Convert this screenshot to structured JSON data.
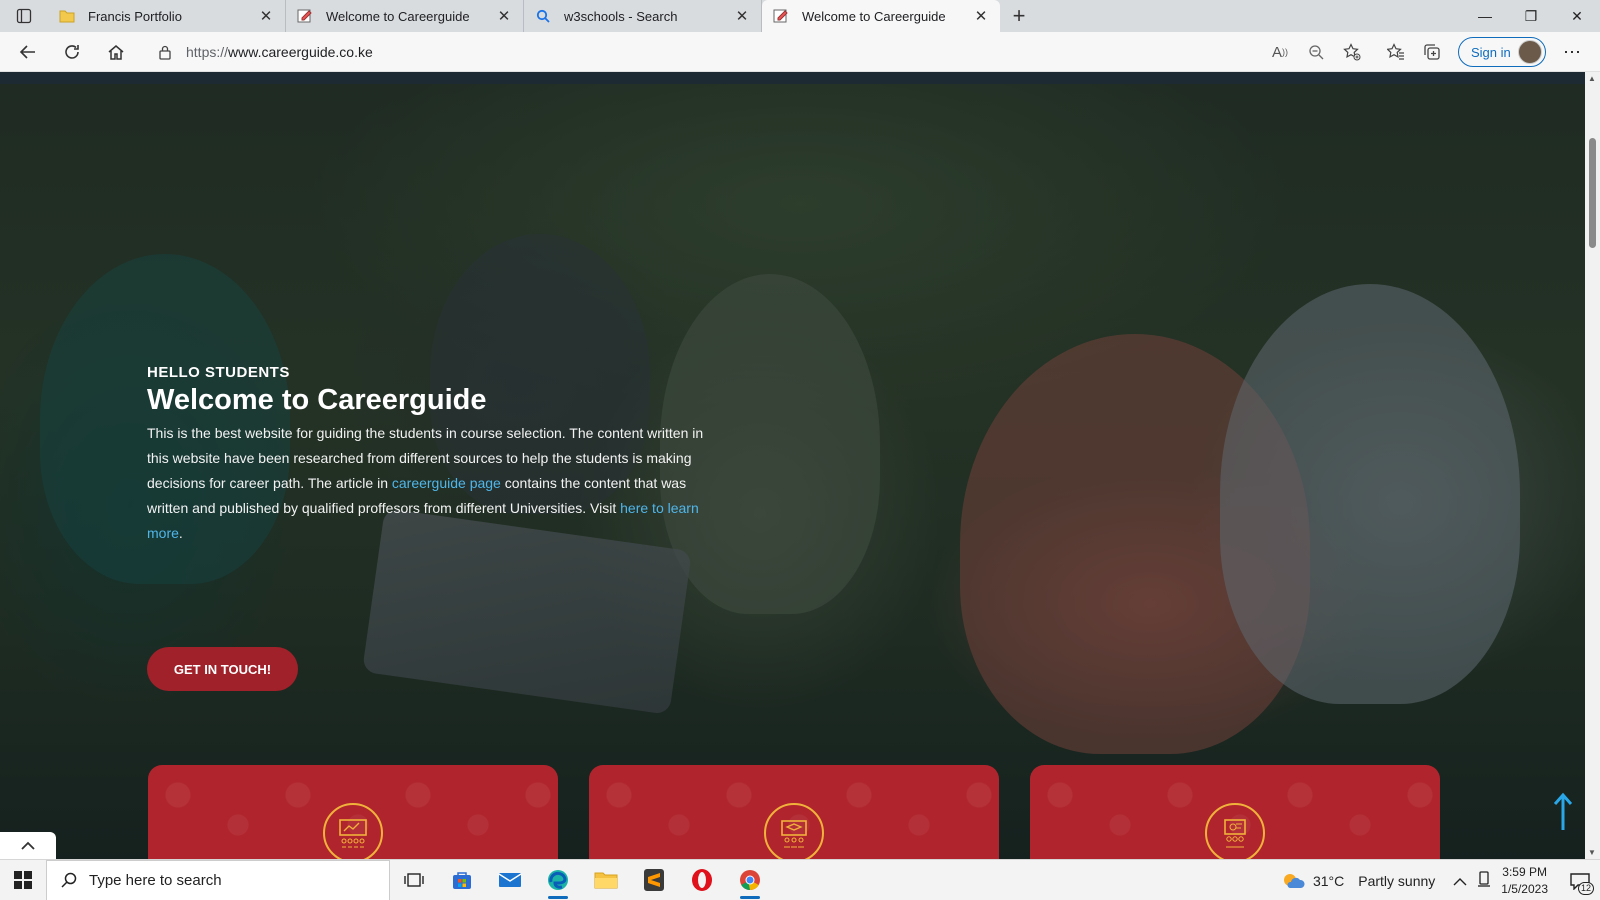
{
  "browser": {
    "tabs": [
      {
        "title": "Francis Portfolio",
        "icon": "folder-icon",
        "active": false
      },
      {
        "title": "Welcome to Careerguide",
        "icon": "careerguide-favicon",
        "active": false
      },
      {
        "title": "w3schools - Search",
        "icon": "search-icon",
        "active": false
      },
      {
        "title": "Welcome to Careerguide",
        "icon": "careerguide-favicon",
        "active": true
      }
    ],
    "new_tab": "+",
    "url_scheme": "https://",
    "url_host": "www.careerguide.co.ke",
    "signin_label": "Sign in"
  },
  "page": {
    "eyebrow": "HELLO STUDENTS",
    "title": "Welcome to Careerguide",
    "paragraph_part1": "This is the best website for guiding the students in course selection. The content written in this website have been researched from different sources to help the students is making decisions for career path. The article in ",
    "link1": "careerguide page",
    "paragraph_part2": " contains the content that was written and published by qualified proffesors from different Universities. Visit ",
    "link2": "here to learn more",
    "paragraph_end": ".",
    "cta_label": "GET IN TOUCH!",
    "cards": [
      {
        "icon": "presentation-board-icon"
      },
      {
        "icon": "graduation-teacher-icon"
      },
      {
        "icon": "students-group-icon"
      }
    ],
    "colors": {
      "accent_red": "#a02129",
      "card_red": "#b0252d",
      "link_blue": "#4fb6ea",
      "badge_gold": "#f0b23a"
    }
  },
  "taskbar": {
    "search_placeholder": "Type here to search",
    "apps": [
      "task-view-icon",
      "store-icon",
      "mail-icon",
      "edge-icon",
      "file-explorer-icon",
      "sublime-icon",
      "opera-icon",
      "chrome-icon"
    ],
    "temperature": "31°C",
    "weather": "Partly sunny",
    "time": "3:59 PM",
    "date": "1/5/2023",
    "notifications": "12"
  }
}
